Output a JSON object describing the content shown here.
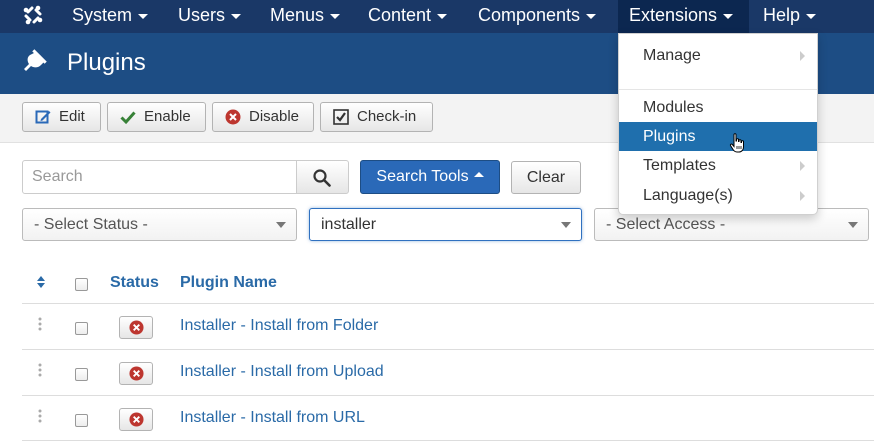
{
  "nav": {
    "items": [
      "System",
      "Users",
      "Menus",
      "Content",
      "Components",
      "Extensions",
      "Help"
    ],
    "active": "Extensions"
  },
  "header": {
    "title": "Plugins"
  },
  "toolbar": {
    "edit": "Edit",
    "enable": "Enable",
    "disable": "Disable",
    "checkin": "Check-in"
  },
  "search": {
    "placeholder": "Search",
    "tools": "Search Tools",
    "clear": "Clear"
  },
  "filters": {
    "status": "- Select Status -",
    "folder": "installer",
    "access": "- Select Access -"
  },
  "table": {
    "headers": {
      "status": "Status",
      "name": "Plugin Name"
    },
    "rows": [
      {
        "name": "Installer - Install from Folder",
        "enabled": false
      },
      {
        "name": "Installer - Install from Upload",
        "enabled": false
      },
      {
        "name": "Installer - Install from URL",
        "enabled": false
      }
    ]
  },
  "menu": {
    "items": [
      {
        "label": "Manage",
        "submenu": true
      },
      {
        "label": "Modules",
        "submenu": false
      },
      {
        "label": "Plugins",
        "submenu": false,
        "active": true
      },
      {
        "label": "Templates",
        "submenu": true
      },
      {
        "label": "Language(s)",
        "submenu": true
      }
    ]
  },
  "colors": {
    "navbar": "#1a3867",
    "header": "#1d4d84",
    "primary": "#2a69b8",
    "link": "#2a6aa7",
    "menu_active": "#1f6fad",
    "danger": "#bd362f",
    "success": "#378137"
  }
}
